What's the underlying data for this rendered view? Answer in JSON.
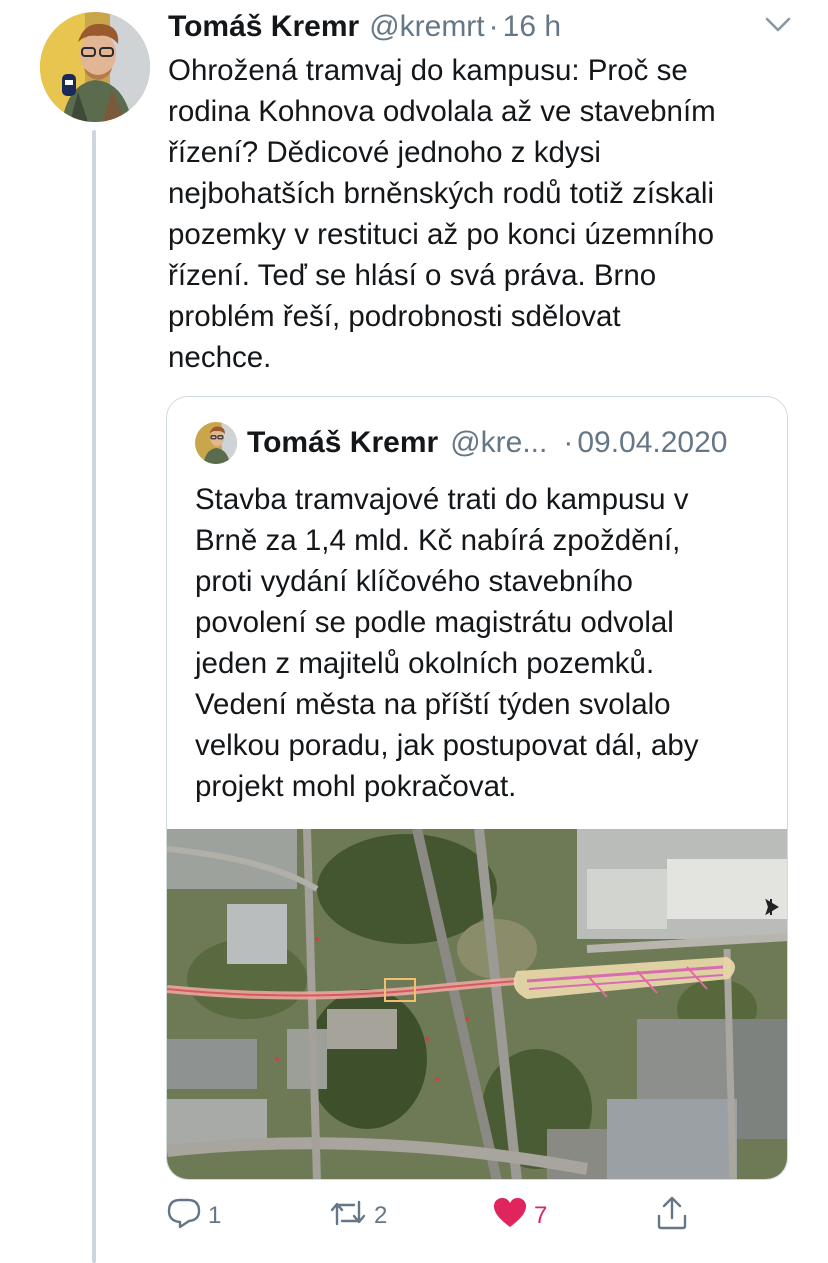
{
  "tweet": {
    "author_name": "Tomáš Kremr",
    "handle": "@kremrt",
    "separator": "·",
    "time": "16 h",
    "text": "Ohrožená tramvaj do kampusu: Proč se\nrodina Kohnova odvolala až ve stavebním\nřízení? Dědicové jednoho z kdysi\nnejbohatších brněnských rodů totiž získali\npozemky v restituci až po konci územního\nřízení. Teď se hlásí o svá práva. Brno\nproblém řeší, podrobnosti sdělovat\nnechce."
  },
  "quoted": {
    "author_name": "Tomáš Kremr",
    "handle": "@kre...",
    "separator": "·",
    "date": "09.04.2020",
    "text": "Stavba tramvajové trati do kampusu v\nBrně za 1,4 mld. Kč nabírá zpoždění,\nproti vydání klíčového stavebního\npovolení se podle magistrátu odvolal\njeden z majitelů okolních pozemků.\nVedení města na příští týden svolalo\nvelkou poradu, jak postupovat dál, aby\nprojekt mohl pokračovat."
  },
  "actions": {
    "reply_count": "1",
    "retweet_count": "2",
    "like_count": "7",
    "like_color": "#e0245e",
    "icon_color": "#657786"
  },
  "icons": [
    "chevron-down-icon",
    "reply-icon",
    "retweet-icon",
    "heart-icon",
    "share-icon"
  ]
}
